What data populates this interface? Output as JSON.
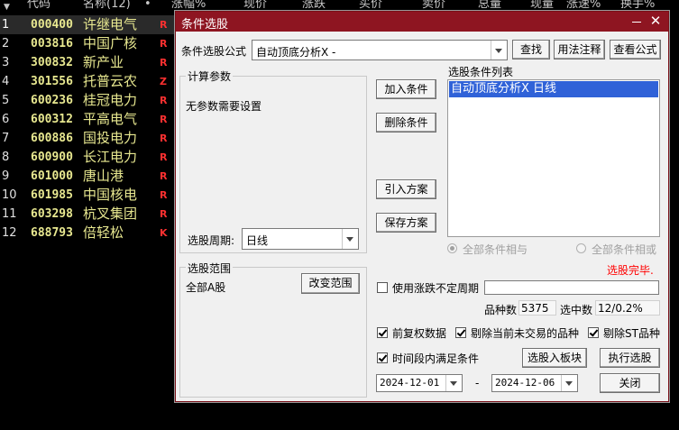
{
  "stock_list": {
    "columns": [
      "代码",
      "名称(12)",
      "•",
      "涨幅%",
      "现价",
      "涨跌",
      "买价",
      "卖价",
      "总量",
      "现量",
      "涨速%",
      "换手%"
    ],
    "rows": [
      {
        "idx": "1",
        "code": "000400",
        "name": "许继电气",
        "flag": "R"
      },
      {
        "idx": "2",
        "code": "003816",
        "name": "中国广核",
        "flag": "R"
      },
      {
        "idx": "3",
        "code": "300832",
        "name": "新产业",
        "flag": "R"
      },
      {
        "idx": "4",
        "code": "301556",
        "name": "托普云农",
        "flag": "Z"
      },
      {
        "idx": "5",
        "code": "600236",
        "name": "桂冠电力",
        "flag": "R"
      },
      {
        "idx": "6",
        "code": "600312",
        "name": "平高电气",
        "flag": "R"
      },
      {
        "idx": "7",
        "code": "600886",
        "name": "国投电力",
        "flag": "R"
      },
      {
        "idx": "8",
        "code": "600900",
        "name": "长江电力",
        "flag": "R"
      },
      {
        "idx": "9",
        "code": "601000",
        "name": "唐山港",
        "flag": "R"
      },
      {
        "idx": "10",
        "code": "601985",
        "name": "中国核电",
        "flag": "R"
      },
      {
        "idx": "11",
        "code": "603298",
        "name": "杭叉集团",
        "flag": "R"
      },
      {
        "idx": "12",
        "code": "688793",
        "name": "倍轻松",
        "flag": "K"
      }
    ]
  },
  "dialog": {
    "title": "条件选股",
    "formula_label": "条件选股公式",
    "formula_value": "自动顶底分析X -",
    "find_button": "查找",
    "usage_button": "用法注释",
    "view_formula_button": "查看公式",
    "params_group": "计算参数",
    "params_text": "无参数需要设置",
    "period_label": "选股周期:",
    "period_value": "日线",
    "add_condition_button": "加入条件",
    "delete_condition_button": "删除条件",
    "import_plan_button": "引入方案",
    "save_plan_button": "保存方案",
    "condition_list_label": "选股条件列表",
    "conditions": [
      "自动顶底分析X  日线"
    ],
    "radio_and_label": "全部条件相与",
    "radio_or_label": "全部条件相或",
    "status_text": "选股完毕.",
    "range_group": "选股范围",
    "range_value": "全部A股",
    "change_range_button": "改变范围",
    "use_limit_period_label": "使用涨跌不定周期",
    "variety_count_label": "品种数",
    "variety_count": "5375",
    "selected_count_label": "选中数",
    "selected_count": "12/0.2%",
    "pre_adjust_label": "前复权数据",
    "exclude_untraded_label": "剔除当前未交易的品种",
    "exclude_st_label": "剔除ST品种",
    "time_range_label": "时间段内满足条件",
    "to_block_button": "选股入板块",
    "execute_button": "执行选股",
    "start_date": "2024-12-01",
    "date_separator": "-",
    "end_date": "2024-12-06",
    "close_button": "关闭"
  },
  "colors": {
    "title_bar": "#8e1521",
    "status_red": "#ff0000",
    "list_selection": "#3062d8",
    "stock_code": "#e8e890",
    "flag_red": "#ff3030"
  }
}
